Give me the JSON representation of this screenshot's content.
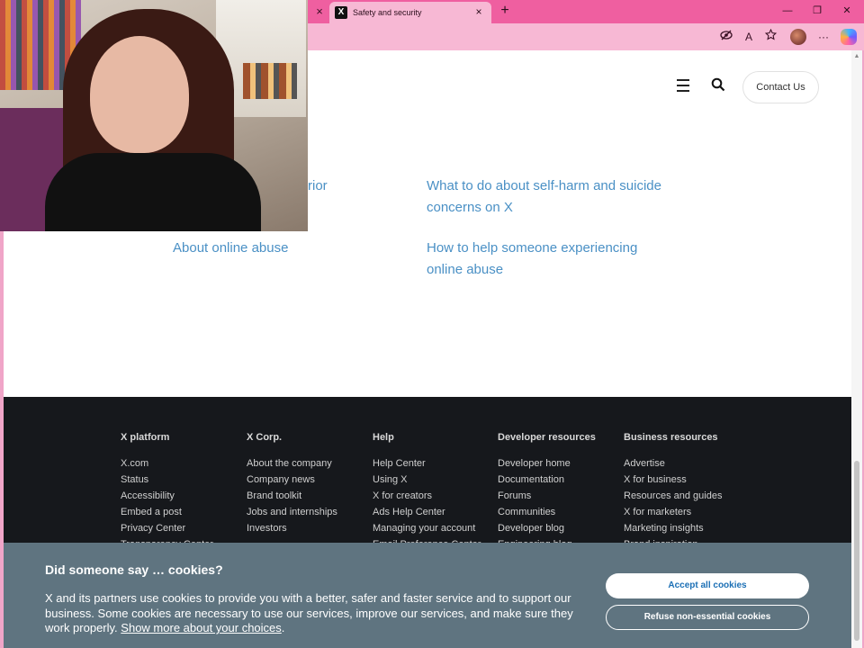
{
  "browser": {
    "prev_tab_close": "×",
    "active_tab": {
      "favicon": "X",
      "title": "Safety and security",
      "close": "×"
    },
    "new_tab": "+",
    "window_controls": {
      "minimize": "—",
      "maximize": "❐",
      "close": "✕"
    },
    "toolbar": {
      "read_aloud": "A",
      "more": "···"
    }
  },
  "header": {
    "contact_label": "Contact Us"
  },
  "links": {
    "left_partial": "rior",
    "left": "About online abuse",
    "right_1": "What to do about self-harm and suicide concerns on X",
    "right_2": "How to help someone experiencing online abuse"
  },
  "footer": {
    "columns": [
      {
        "title": "X platform",
        "items": [
          "X.com",
          "Status",
          "Accessibility",
          "Embed a post",
          "Privacy Center",
          "Transparency Center"
        ]
      },
      {
        "title": "X Corp.",
        "items": [
          "About the company",
          "Company news",
          "Brand toolkit",
          "Jobs and internships",
          "Investors"
        ]
      },
      {
        "title": "Help",
        "items": [
          "Help Center",
          "Using X",
          "X for creators",
          "Ads Help Center",
          "Managing your account",
          "Email Preference Center"
        ]
      },
      {
        "title": "Developer resources",
        "items": [
          "Developer home",
          "Documentation",
          "Forums",
          "Communities",
          "Developer blog",
          "Engineering blog"
        ]
      },
      {
        "title": "Business resources",
        "items": [
          "Advertise",
          "X for business",
          "Resources and guides",
          "X for marketers",
          "Marketing insights",
          "Brand inspiration"
        ]
      }
    ]
  },
  "cookie": {
    "title": "Did someone say … cookies?",
    "body": "X and its partners use cookies to provide you with a better, safer and faster service and to support our business. Some cookies are necessary to use our services, improve our services, and make sure they work properly. ",
    "link": "Show more about your choices",
    "end": ".",
    "accept": "Accept all cookies",
    "refuse": "Refuse non-essential cookies"
  },
  "colors": {
    "tabbar": "#ef5fa0",
    "link": "#4a90c5",
    "footer": "#16181c",
    "cookie_banner": "#5f7480"
  }
}
